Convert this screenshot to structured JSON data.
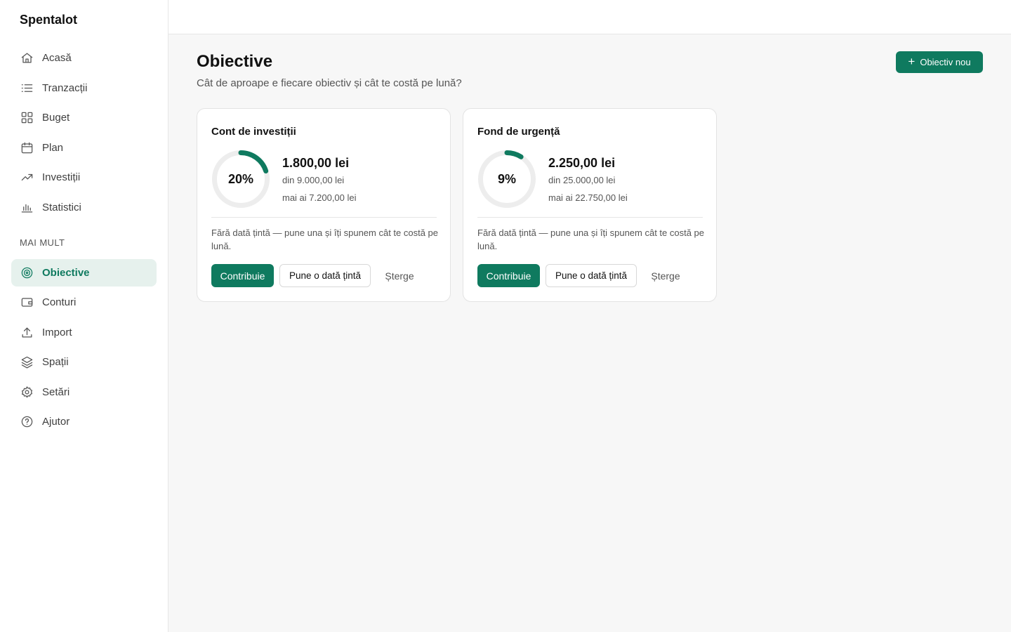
{
  "app": {
    "name": "Spentalot"
  },
  "sidebar": {
    "items": [
      {
        "label": "Acasă",
        "icon": "home-icon"
      },
      {
        "label": "Tranzacții",
        "icon": "list-icon"
      },
      {
        "label": "Buget",
        "icon": "grid-icon"
      },
      {
        "label": "Plan",
        "icon": "calendar-icon"
      },
      {
        "label": "Investiții",
        "icon": "trending-up-icon"
      },
      {
        "label": "Statistici",
        "icon": "bar-chart-icon"
      }
    ],
    "section_label": "MAI MULT",
    "more_items": [
      {
        "label": "Obiective",
        "icon": "target-icon",
        "active": true
      },
      {
        "label": "Conturi",
        "icon": "wallet-icon"
      },
      {
        "label": "Import",
        "icon": "upload-icon"
      },
      {
        "label": "Spații",
        "icon": "layers-icon"
      },
      {
        "label": "Setări",
        "icon": "gear-icon"
      },
      {
        "label": "Ajutor",
        "icon": "help-circle-icon"
      }
    ]
  },
  "header": {
    "title": "Obiective",
    "subtitle": "Cât de aproape e fiecare obiectiv și cât te costă pe lună?",
    "new_button_label": "Obiectiv nou"
  },
  "goals": [
    {
      "name": "Cont de investiții",
      "progress_percent": 20,
      "progress_label": "20%",
      "saved": "1.800,00 lei",
      "target": "din 9.000,00 lei",
      "remaining": "mai ai 7.200,00 lei",
      "note": "Fără dată țintă — pune una și îți spunem cât te costă pe lună.",
      "contribute_label": "Contribuie",
      "set_date_label": "Pune o dată țintă",
      "delete_label": "Șterge"
    },
    {
      "name": "Fond de urgență",
      "progress_percent": 9,
      "progress_label": "9%",
      "saved": "2.250,00 lei",
      "target": "din 25.000,00 lei",
      "remaining": "mai ai 22.750,00 lei",
      "note": "Fără dată țintă — pune una și îți spunem cât te costă pe lună.",
      "contribute_label": "Contribuie",
      "set_date_label": "Pune o dată țintă",
      "delete_label": "Șterge"
    }
  ],
  "colors": {
    "accent": "#0f7a5f",
    "accent_bg": "#e6f1ed",
    "ring_track": "#ededed"
  }
}
